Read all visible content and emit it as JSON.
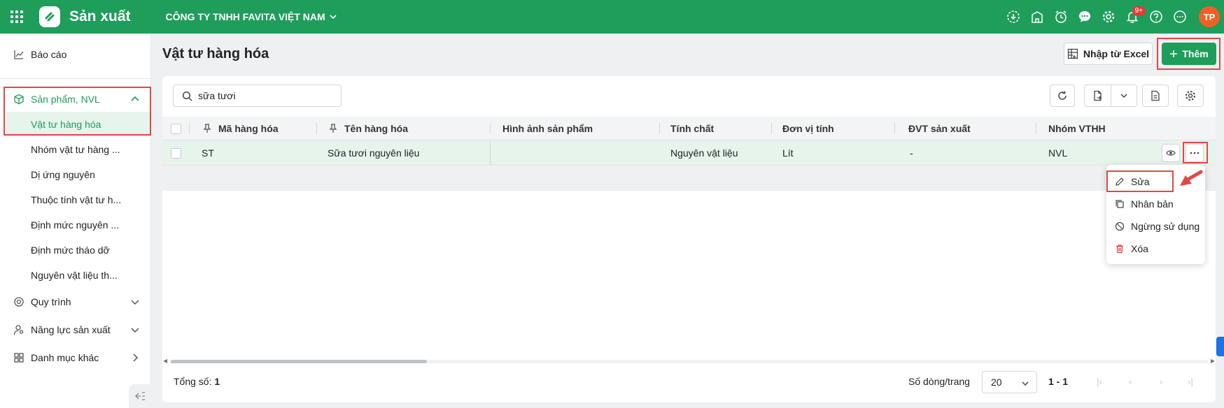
{
  "header": {
    "app_title": "Sản xuất",
    "company": "CÔNG TY TNHH FAVITA VIỆT NAM",
    "notification_badge": "9+",
    "avatar_initials": "TP",
    "icons": [
      "download-icon",
      "building-icon",
      "alarm-clock-icon",
      "chat-icon",
      "gear-icon",
      "bell-icon",
      "help-icon",
      "more-icon"
    ]
  },
  "sidebar": {
    "report": "Báo cáo",
    "group_products": "Sản phẩm, NVL",
    "sub_items": [
      "Vật tư hàng hóa",
      "Nhóm vật tư hàng ...",
      "Dị ứng nguyên",
      "Thuộc tính vật tư h...",
      "Định mức nguyên ...",
      "Định mức tháo dỡ",
      "Nguyên vật liệu th..."
    ],
    "process": "Quy trình",
    "capacity": "Năng lực sản xuất",
    "other_catalog": "Danh mục khác"
  },
  "page": {
    "title": "Vật tư hàng hóa",
    "import_excel": "Nhập từ Excel",
    "add": "Thêm"
  },
  "search": {
    "value": "sữa tươi"
  },
  "table": {
    "columns": [
      "Mã hàng hóa",
      "Tên hàng hóa",
      "Hình ảnh sản phẩm",
      "Tính chất",
      "Đơn vị tính",
      "ĐVT sản xuất",
      "Nhóm VTHH"
    ],
    "rows": [
      {
        "code": "ST",
        "name": "Sữa tươi nguyên liệu",
        "image": "",
        "nature": "Nguyên vật liệu",
        "unit": "Lít",
        "prod_unit": "-",
        "group": "NVL"
      }
    ]
  },
  "context_menu": {
    "edit": "Sửa",
    "duplicate": "Nhân bản",
    "deactivate": "Ngừng sử dụng",
    "delete": "Xóa"
  },
  "footer": {
    "total_label": "Tổng số:",
    "total_value": "1",
    "rows_per_page_label": "Số dòng/trang",
    "rows_per_page": "20",
    "range": "1 - 1"
  },
  "colors": {
    "brand": "#1f9d5b",
    "highlight": "#e04848",
    "avatar": "#f06026"
  }
}
